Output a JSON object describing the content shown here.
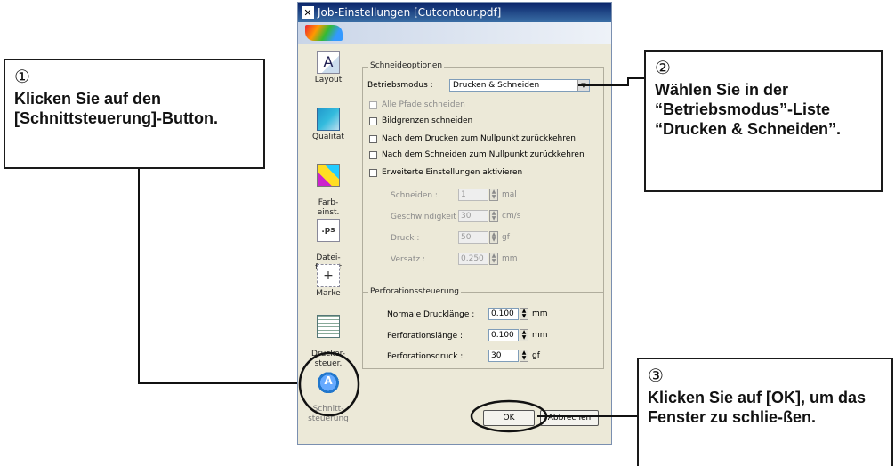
{
  "window": {
    "title": "Job-Einstellungen [Cutcontour.pdf]"
  },
  "sidebar": {
    "items": [
      {
        "label": "Layout"
      },
      {
        "label": "Qualität"
      },
      {
        "label": "Farb-\neinst."
      },
      {
        "label": "Datei-\nformat"
      },
      {
        "label": "Marke"
      },
      {
        "label": "Drucker-\nsteuer."
      },
      {
        "label": "Schnitt-\nsteuerung"
      }
    ]
  },
  "schneideoptionen": {
    "group_title": "Schneideoptionen",
    "betriebsmodus_label": "Betriebsmodus :",
    "betriebsmodus_value": "Drucken & Schneiden",
    "checks": [
      {
        "label": "Alle Pfade schneiden",
        "disabled": true
      },
      {
        "label": "Bildgrenzen schneiden",
        "disabled": false
      },
      {
        "label": "Nach dem Drucken zum Nullpunkt zurückkehren",
        "disabled": false
      },
      {
        "label": "Nach dem Schneiden zum Nullpunkt zurückkehren",
        "disabled": false
      },
      {
        "label": "Erweiterte Einstellungen aktivieren",
        "disabled": false
      }
    ],
    "fields": [
      {
        "label": "Schneiden :",
        "value": "1",
        "unit": "mal"
      },
      {
        "label": "Geschwindigkeit :",
        "value": "30",
        "unit": "cm/s"
      },
      {
        "label": "Druck :",
        "value": "50",
        "unit": "gf"
      },
      {
        "label": "Versatz :",
        "value": "0.250",
        "unit": "mm"
      }
    ]
  },
  "perforation": {
    "group_title": "Perforationssteuerung",
    "fields": [
      {
        "label": "Normale Drucklänge :",
        "value": "0.100",
        "unit": "mm"
      },
      {
        "label": "Perforationslänge :",
        "value": "0.100",
        "unit": "mm"
      },
      {
        "label": "Perforationsdruck :",
        "value": "30",
        "unit": "gf"
      }
    ]
  },
  "buttons": {
    "ok": "OK",
    "cancel": "Abbrechen"
  },
  "callouts": {
    "c1": {
      "num": "①",
      "text": "Klicken Sie auf den [Schnittsteuerung]-Button."
    },
    "c2": {
      "num": "②",
      "text": "Wählen Sie in der “Betriebsmodus”-Liste “Drucken & Schneiden”."
    },
    "c3": {
      "num": "③",
      "text": "Klicken Sie auf [OK], um das Fenster zu schlie-ßen."
    }
  }
}
